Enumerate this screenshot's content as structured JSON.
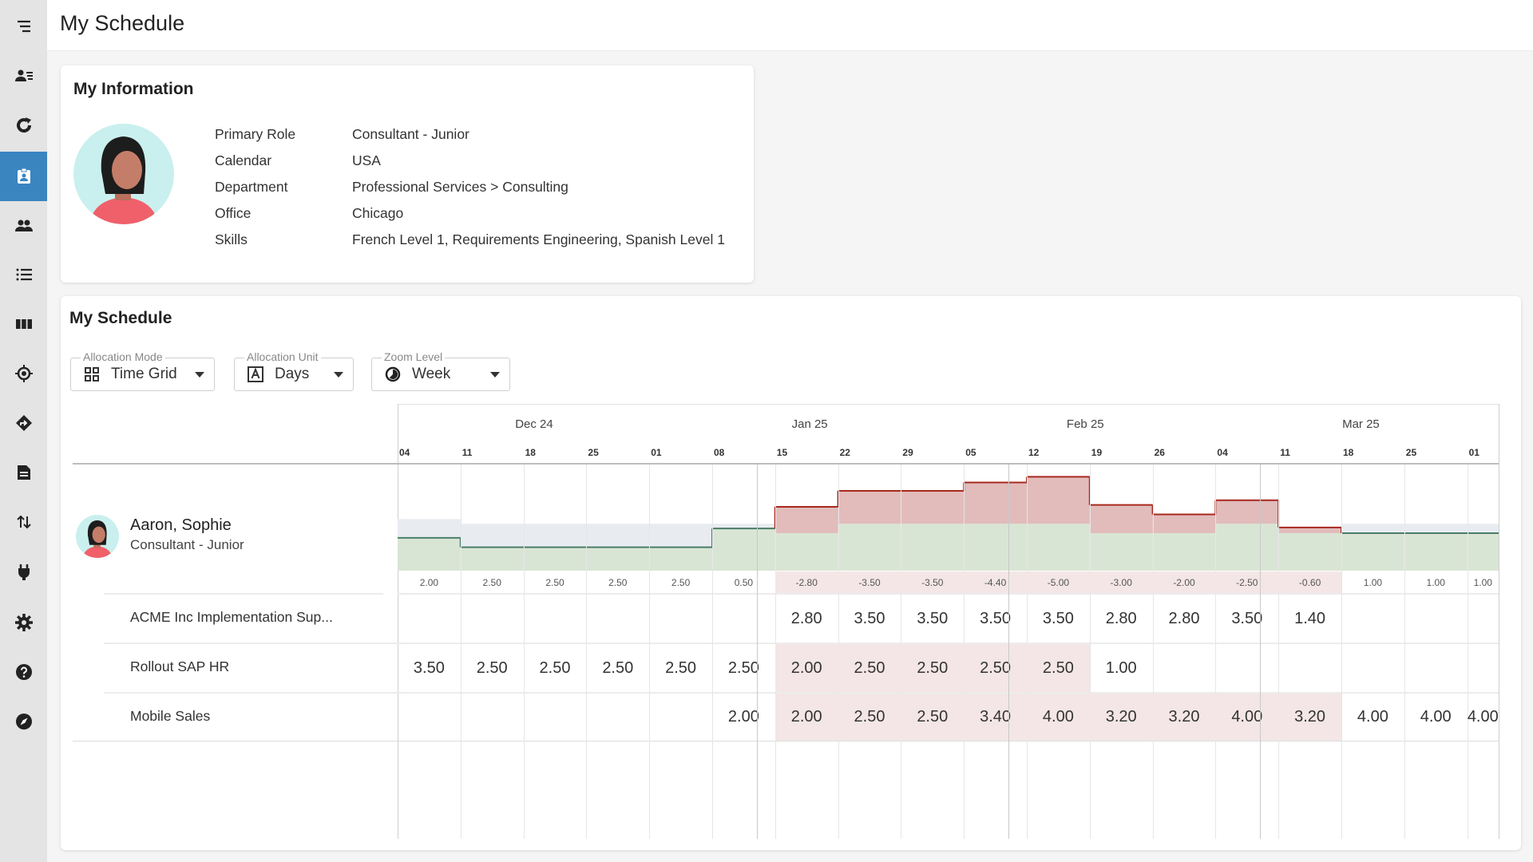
{
  "header": {
    "title": "My Schedule"
  },
  "sidebar": {
    "items": [
      {
        "icon": "menu-icon",
        "active": false
      },
      {
        "icon": "people-list-icon",
        "active": false
      },
      {
        "icon": "refresh-icon",
        "active": false
      },
      {
        "icon": "badge-icon",
        "active": true
      },
      {
        "icon": "group-icon",
        "active": false
      },
      {
        "icon": "list-icon",
        "active": false
      },
      {
        "icon": "columns-icon",
        "active": false
      },
      {
        "icon": "target-icon",
        "active": false
      },
      {
        "icon": "directions-icon",
        "active": false
      },
      {
        "icon": "document-icon",
        "active": false
      },
      {
        "icon": "swap-icon",
        "active": false
      },
      {
        "icon": "plug-icon",
        "active": false
      },
      {
        "icon": "gear-icon",
        "active": false
      },
      {
        "icon": "help-icon",
        "active": false
      },
      {
        "icon": "compass-icon",
        "active": false
      }
    ],
    "active_color": "#3a84c0"
  },
  "info": {
    "title": "My Information",
    "rows": [
      {
        "label": "Primary Role",
        "value": "Consultant - Junior"
      },
      {
        "label": "Calendar",
        "value": "USA"
      },
      {
        "label": "Department",
        "value": "Professional Services > Consulting"
      },
      {
        "label": "Office",
        "value": "Chicago"
      },
      {
        "label": "Skills",
        "value": "French Level 1, Requirements Engineering, Spanish Level 1"
      }
    ]
  },
  "schedule": {
    "title": "My Schedule",
    "controls": [
      {
        "legend": "Allocation Mode",
        "value": "Time Grid",
        "icon": "grid-icon"
      },
      {
        "legend": "Allocation Unit",
        "value": "Days",
        "icon": "letter-a-icon"
      },
      {
        "legend": "Zoom Level",
        "value": "Week",
        "icon": "clock-icon"
      }
    ],
    "months": [
      "Dec 24",
      "Jan 25",
      "Feb 25",
      "Mar 25"
    ],
    "weeks": [
      "04",
      "11",
      "18",
      "25",
      "01",
      "08",
      "15",
      "22",
      "29",
      "05",
      "12",
      "19",
      "26",
      "04",
      "11",
      "18",
      "25",
      "01"
    ],
    "person": {
      "name": "Aaron, Sophie",
      "role": "Consultant - Junior"
    },
    "balance": [
      "2.00",
      "2.50",
      "2.50",
      "2.50",
      "2.50",
      "0.50",
      "-2.80",
      "-3.50",
      "-3.50",
      "-4.40",
      "-5.00",
      "-3.00",
      "-2.00",
      "-2.50",
      "-0.60",
      "1.00",
      "1.00",
      "1.00"
    ],
    "projects": [
      {
        "name": "ACME Inc Implementation Sup...",
        "values": [
          "",
          "",
          "",
          "",
          "",
          "",
          "2.80",
          "3.50",
          "3.50",
          "3.50",
          "3.50",
          "2.80",
          "2.80",
          "3.50",
          "1.40",
          "",
          "",
          ""
        ],
        "overallocated": []
      },
      {
        "name": "Rollout SAP HR",
        "values": [
          "3.50",
          "2.50",
          "2.50",
          "2.50",
          "2.50",
          "2.50",
          "2.00",
          "2.50",
          "2.50",
          "2.50",
          "2.50",
          "1.00",
          "",
          "",
          "",
          "",
          "",
          ""
        ],
        "overallocated": [
          6,
          7,
          8,
          9,
          10
        ]
      },
      {
        "name": "Mobile Sales",
        "values": [
          "",
          "",
          "",
          "",
          "",
          "2.00",
          "2.00",
          "2.50",
          "2.50",
          "3.40",
          "4.00",
          "3.20",
          "3.20",
          "4.00",
          "3.20",
          "4.00",
          "4.00",
          "4.00"
        ],
        "overallocated": [
          6,
          7,
          8,
          9,
          10,
          11,
          12,
          13,
          14
        ]
      }
    ],
    "colors": {
      "booked": "#d9e5d4",
      "available": "#e8ecf1",
      "over": "#e1bcbb",
      "over_line": "#a8291e",
      "ok_line": "#4a7d68",
      "over_cell": "#f4e6e6"
    }
  }
}
